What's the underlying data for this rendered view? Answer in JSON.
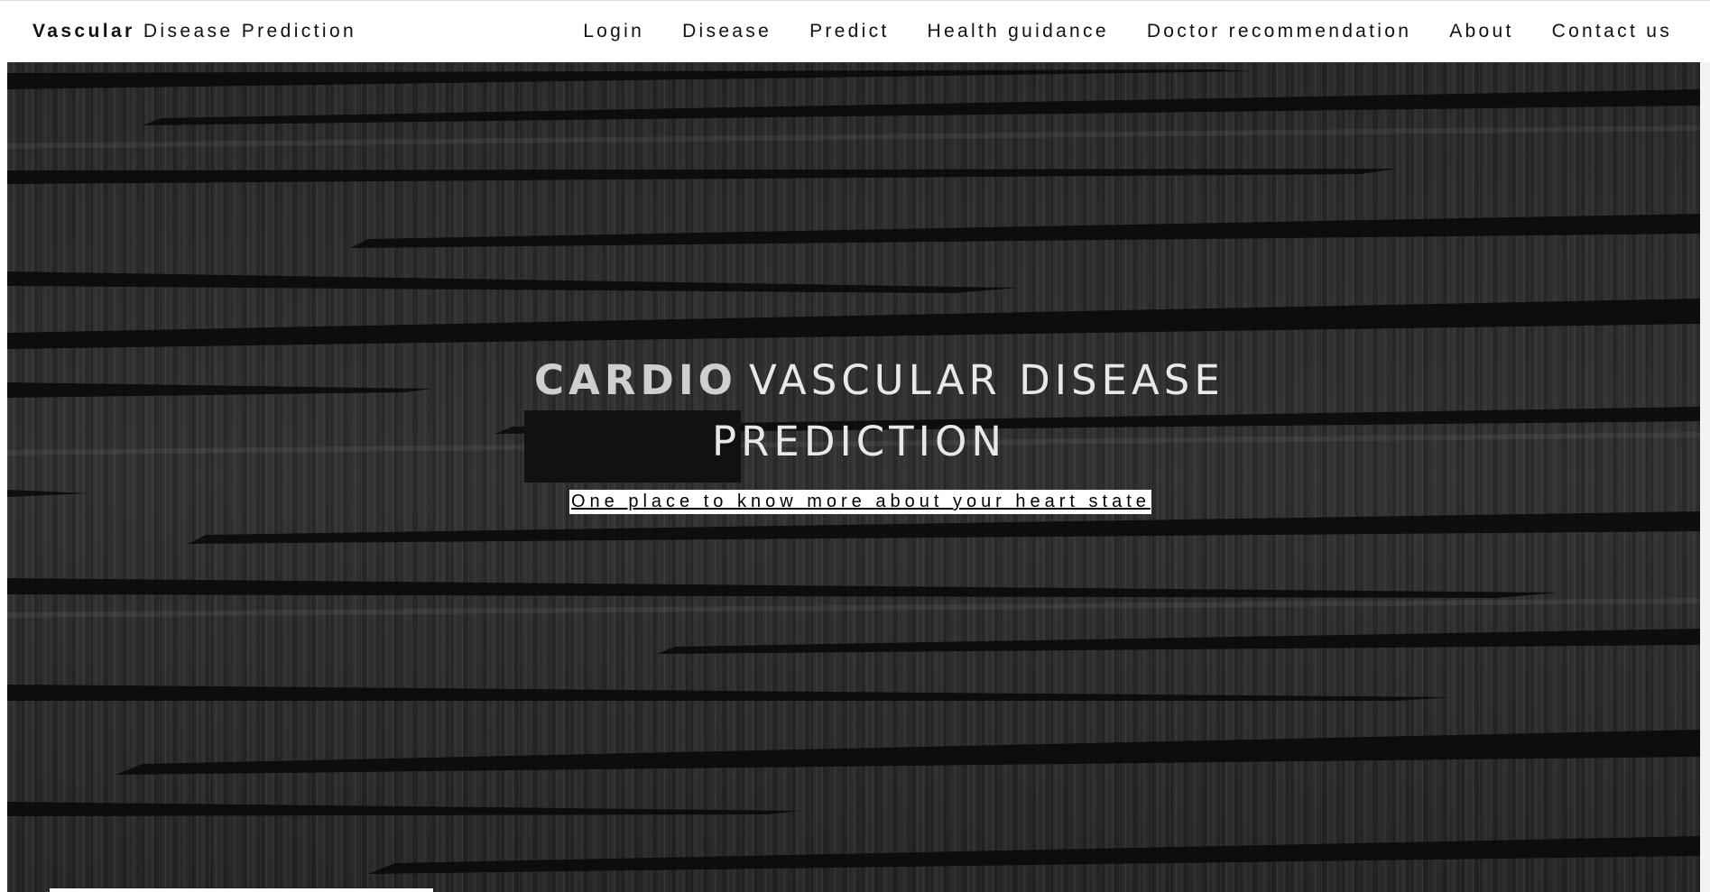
{
  "navbar": {
    "brand_bold": "Vascular",
    "brand_rest": " Disease Prediction",
    "links": [
      "Login",
      "Disease",
      "Predict",
      "Health guidance",
      "Doctor recommendation",
      "About",
      "Contact us"
    ]
  },
  "hero": {
    "title_highlight": "CARDIO",
    "title_line1": "VASCULAR DISEASE",
    "title_line2": "PREDICTION",
    "tagline": "One place to know more about your heart state"
  },
  "colors": {
    "nav_bg": "#ffffff",
    "hero_bg": "#2a2a2a",
    "highlight_box": "#111111",
    "tagline_bg": "#ffffff"
  }
}
